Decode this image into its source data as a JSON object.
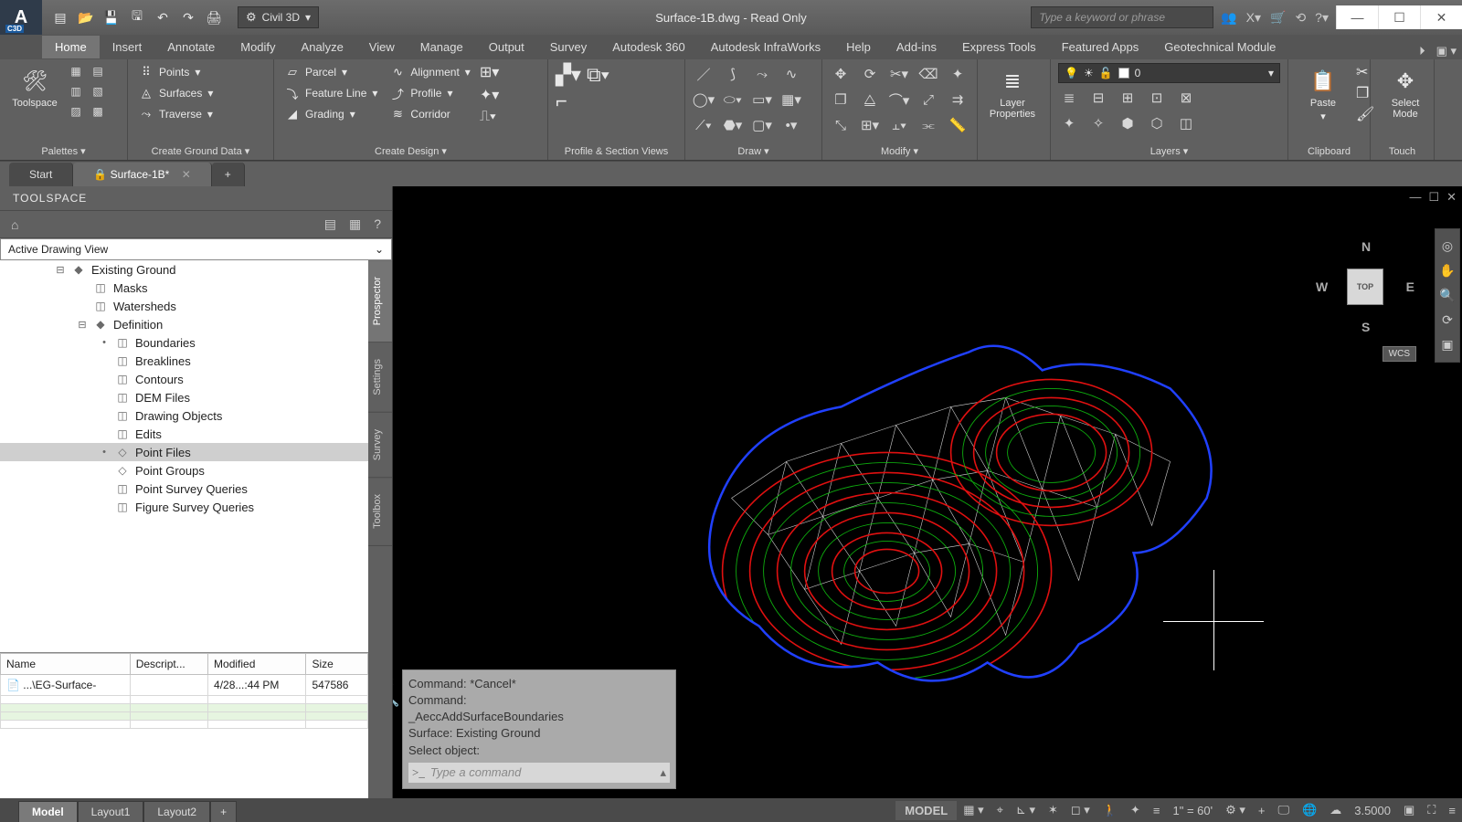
{
  "app": {
    "name_short": "C3D",
    "workspace": "Civil 3D",
    "title": "Surface-1B.dwg - Read Only"
  },
  "search": {
    "placeholder": "Type a keyword or phrase"
  },
  "menu": {
    "items": [
      "Home",
      "Insert",
      "Annotate",
      "Modify",
      "Analyze",
      "View",
      "Manage",
      "Output",
      "Survey",
      "Autodesk 360",
      "Autodesk InfraWorks",
      "Help",
      "Add-ins",
      "Express Tools",
      "Featured Apps",
      "Geotechnical Module"
    ],
    "active": 0
  },
  "ribbon": {
    "panels": [
      {
        "title": "Palettes",
        "dd": true,
        "big": {
          "label": "Toolspace"
        }
      },
      {
        "title": "Create Ground Data",
        "dd": true,
        "rows": [
          "Points",
          "Surfaces",
          "Traverse"
        ]
      },
      {
        "title": "Create Design",
        "dd": true,
        "colA": [
          "Parcel",
          "Feature Line",
          "Grading"
        ],
        "colB": [
          "Alignment",
          "Profile",
          "Corridor"
        ]
      },
      {
        "title": "Profile & Section Views"
      },
      {
        "title": "Draw",
        "dd": true
      },
      {
        "title": "Modify",
        "dd": true
      },
      {
        "title": "",
        "big": {
          "label": "Layer\nProperties"
        }
      },
      {
        "title": "Layers",
        "dd": true,
        "layer_value": "0"
      },
      {
        "title": "Clipboard",
        "big": {
          "label": "Paste"
        }
      },
      {
        "title": "Touch",
        "big": {
          "label": "Select\nMode"
        }
      }
    ]
  },
  "doctabs": {
    "items": [
      "Start",
      "Surface-1B*"
    ],
    "active": 1
  },
  "toolspace": {
    "title": "TOOLSPACE",
    "view": "Active Drawing View",
    "vtabs": [
      "Prospector",
      "Settings",
      "Survey",
      "Toolbox"
    ],
    "tree": [
      {
        "d": 1,
        "exp": "-",
        "ico": "◆",
        "label": "Existing Ground"
      },
      {
        "d": 2,
        "exp": "",
        "ico": "◫",
        "label": "Masks"
      },
      {
        "d": 2,
        "exp": "",
        "ico": "◫",
        "label": "Watersheds"
      },
      {
        "d": 2,
        "exp": "-",
        "ico": "◆",
        "label": "Definition"
      },
      {
        "d": 3,
        "exp": "•",
        "ico": "◫",
        "label": "Boundaries"
      },
      {
        "d": 3,
        "exp": "",
        "ico": "◫",
        "label": "Breaklines"
      },
      {
        "d": 3,
        "exp": "",
        "ico": "◫",
        "label": "Contours"
      },
      {
        "d": 3,
        "exp": "",
        "ico": "◫",
        "label": "DEM Files"
      },
      {
        "d": 3,
        "exp": "",
        "ico": "◫",
        "label": "Drawing Objects"
      },
      {
        "d": 3,
        "exp": "",
        "ico": "◫",
        "label": "Edits"
      },
      {
        "d": 3,
        "exp": "•",
        "ico": "◇",
        "label": "Point Files",
        "sel": true
      },
      {
        "d": 3,
        "exp": "",
        "ico": "◇",
        "label": "Point Groups"
      },
      {
        "d": 3,
        "exp": "",
        "ico": "◫",
        "label": "Point Survey Queries"
      },
      {
        "d": 3,
        "exp": "",
        "ico": "◫",
        "label": "Figure Survey Queries"
      }
    ],
    "grid": {
      "cols": [
        "Name",
        "Descript...",
        "Modified",
        "Size"
      ],
      "rows": [
        {
          "name": "...\\EG-Surface-",
          "desc": "",
          "mod": "4/28...:44 PM",
          "size": "547586"
        }
      ]
    }
  },
  "viewport": {
    "cube_face": "TOP",
    "dirs": {
      "N": "N",
      "S": "S",
      "E": "E",
      "W": "W"
    },
    "wcs": "WCS"
  },
  "cmd": {
    "history": [
      "Command: *Cancel*",
      "Command:",
      "_AeccAddSurfaceBoundaries",
      "Surface:  Existing Ground",
      "Select object:"
    ],
    "prompt": ">_",
    "placeholder": "Type a command"
  },
  "status": {
    "layouts": [
      "Model",
      "Layout1",
      "Layout2"
    ],
    "active": 0,
    "model_label": "MODEL",
    "scale": "1\" = 60'",
    "coord": "3.5000"
  }
}
